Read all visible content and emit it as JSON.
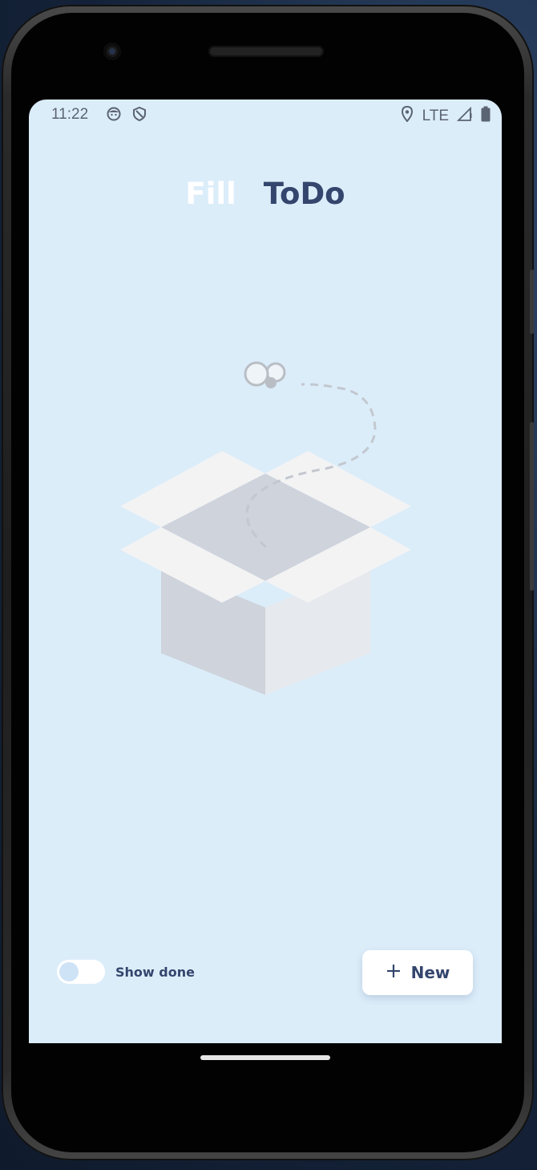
{
  "status_bar": {
    "time": "11:22",
    "network": "LTE",
    "icons": [
      "app-notification-icon",
      "shield-icon",
      "location-icon",
      "signal-icon",
      "battery-icon"
    ]
  },
  "app": {
    "title_part1": "Fill",
    "title_part2": "ToDo",
    "colors": {
      "background": "#dcedfa",
      "accent": "#34466d",
      "title_light": "#ffffff"
    }
  },
  "empty_state": {
    "illustration": "empty-box-illustration"
  },
  "bottom_bar": {
    "toggle_label": "Show done",
    "toggle_on": false,
    "new_button_label": "New"
  }
}
